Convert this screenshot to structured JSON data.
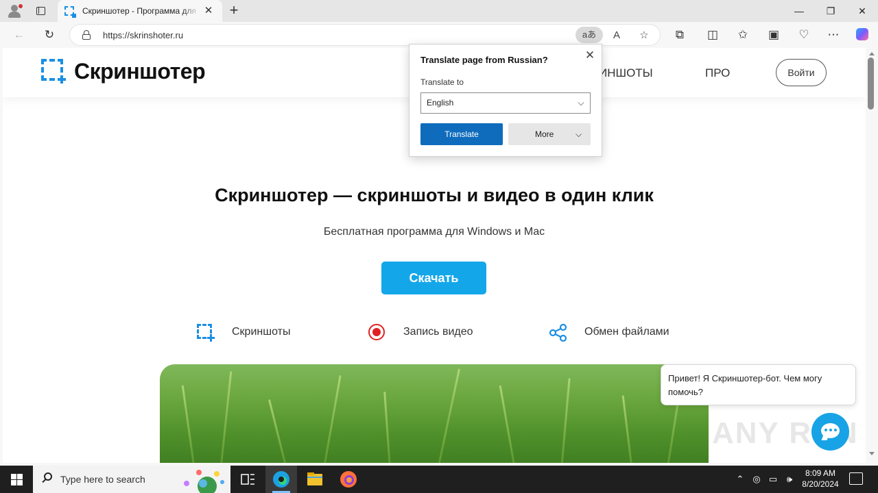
{
  "browser": {
    "tab_title": "Скриншотер - Программа для",
    "address": "https://skrinshoter.ru",
    "translate_indicator": "aあ"
  },
  "translate_popup": {
    "title": "Translate page from Russian?",
    "target_label": "Translate to",
    "selected_language": "English",
    "translate_button": "Translate",
    "more_button": "More"
  },
  "site": {
    "logo_text": "Скриншотер",
    "nav": {
      "screenshots": "ИНШОТЫ",
      "pro": "ПРО",
      "login": "Войти"
    },
    "hero": {
      "title": "Скриншотер — скриншоты и видео в один клик",
      "subtitle": "Бесплатная программа для Windows и Mac",
      "download": "Скачать"
    },
    "features": [
      {
        "label": "Скриншоты",
        "icon": "screenshot-icon"
      },
      {
        "label": "Запись видео",
        "icon": "record-icon"
      },
      {
        "label": "Обмен файлами",
        "icon": "share-icon"
      }
    ],
    "chat_message": "Привет! Я Скриншотер-бот. Чем могу помочь?"
  },
  "watermark": "ANY RUN",
  "taskbar": {
    "search_placeholder": "Type here to search",
    "time": "8:09 AM",
    "date": "8/20/2024"
  },
  "colors": {
    "brand_blue": "#1a8fe3",
    "download_button": "#13a7ea",
    "record_red": "#e02020",
    "translate_button": "#0f6cbd",
    "chat_button": "#18a3e6"
  }
}
